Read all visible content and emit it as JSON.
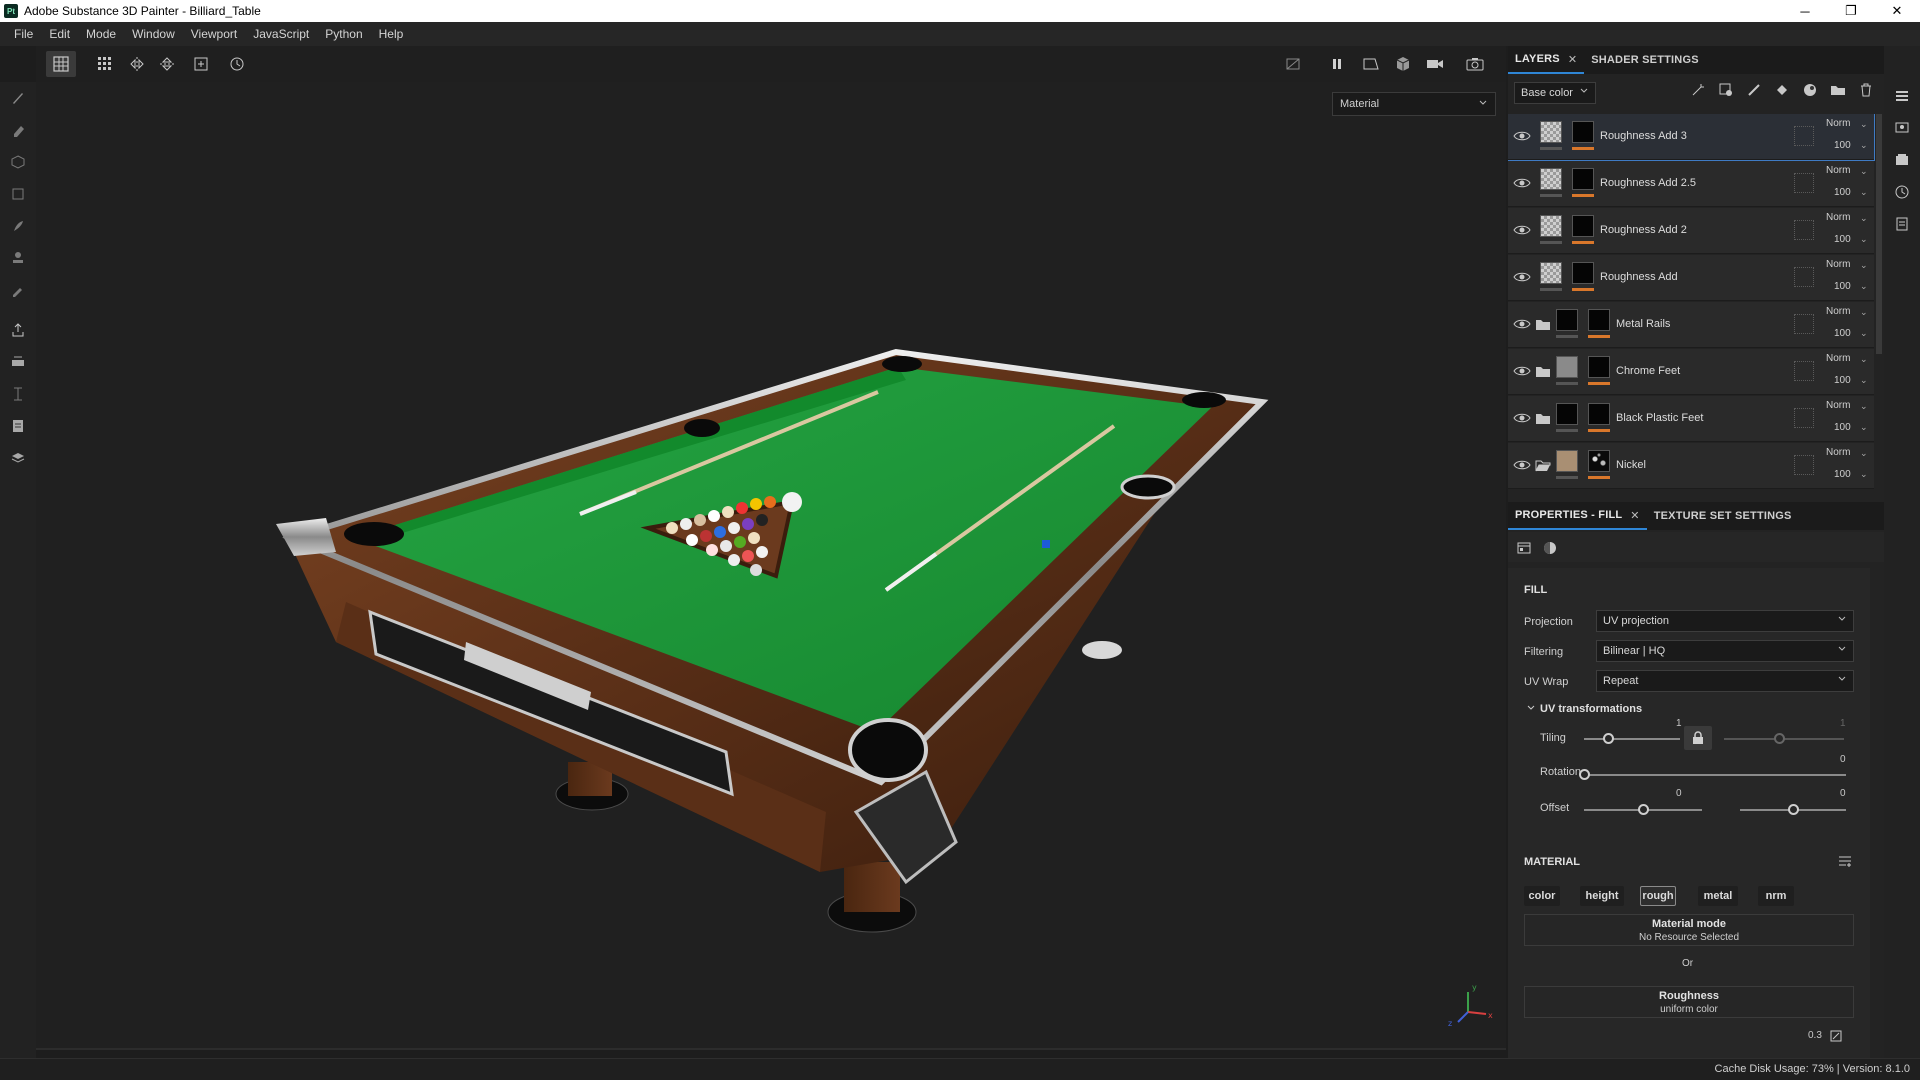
{
  "window": {
    "title": "Adobe Substance 3D Painter - Billiard_Table",
    "app_icon_text": "Pt",
    "controls": [
      "─",
      "❐",
      "✕"
    ]
  },
  "menu": [
    "File",
    "Edit",
    "Mode",
    "Window",
    "Viewport",
    "JavaScript",
    "Python",
    "Help"
  ],
  "viewport": {
    "mode_select": "Material",
    "axis_gizmo": {
      "x": "x",
      "y": "y",
      "z": "z"
    }
  },
  "layers_panel": {
    "tabs": [
      {
        "label": "LAYERS",
        "closable": true,
        "active": true
      },
      {
        "label": "SHADER SETTINGS",
        "closable": false,
        "active": false
      }
    ],
    "channel_select": "Base color",
    "layers": [
      {
        "name": "Roughness Add 3",
        "type": "fill",
        "thumb1": "checker",
        "thumb2": "black",
        "blend": "Norm",
        "opacity": "100",
        "selected": true
      },
      {
        "name": "Roughness Add 2.5",
        "type": "fill",
        "thumb1": "checker",
        "thumb2": "black",
        "blend": "Norm",
        "opacity": "100",
        "selected": false
      },
      {
        "name": "Roughness Add 2",
        "type": "fill",
        "thumb1": "checker",
        "thumb2": "black",
        "blend": "Norm",
        "opacity": "100",
        "selected": false
      },
      {
        "name": "Roughness Add",
        "type": "fill",
        "thumb1": "checker",
        "thumb2": "black",
        "blend": "Norm",
        "opacity": "100",
        "selected": false
      },
      {
        "name": "Metal Rails",
        "type": "folder",
        "thumb1": "black",
        "thumb2": "black",
        "blend": "Norm",
        "opacity": "100",
        "selected": false
      },
      {
        "name": "Chrome Feet",
        "type": "folder",
        "thumb1": "grey",
        "thumb2": "black",
        "blend": "Norm",
        "opacity": "100",
        "selected": false
      },
      {
        "name": "Black Plastic Feet",
        "type": "folder",
        "thumb1": "black",
        "thumb2": "black",
        "blend": "Norm",
        "opacity": "100",
        "selected": false
      },
      {
        "name": "Nickel",
        "type": "folder-open",
        "thumb1": "tan",
        "thumb2": "noise",
        "blend": "Norm",
        "opacity": "100",
        "selected": false
      }
    ]
  },
  "properties_panel": {
    "tabs": [
      {
        "label": "PROPERTIES - FILL",
        "closable": true,
        "active": true
      },
      {
        "label": "TEXTURE SET SETTINGS",
        "closable": false,
        "active": false
      }
    ],
    "fill": {
      "title": "FILL",
      "projection_label": "Projection",
      "projection_value": "UV projection",
      "filtering_label": "Filtering",
      "filtering_value": "Bilinear | HQ",
      "uvwrap_label": "UV Wrap",
      "uvwrap_value": "Repeat"
    },
    "uv_transformations": {
      "title": "UV transformations",
      "tiling_label": "Tiling",
      "tiling_value": "1",
      "tiling_value_locked": "1",
      "rotation_label": "Rotation",
      "rotation_value": "0",
      "offset_label": "Offset",
      "offset_u": "0",
      "offset_v": "0",
      "tiling_level": 0.25,
      "rotation_level": 0.0,
      "offset_u_level": 0.5,
      "offset_v_level": 0.5
    },
    "material": {
      "title": "MATERIAL",
      "channels": [
        {
          "label": "color",
          "on": false
        },
        {
          "label": "height",
          "on": false
        },
        {
          "label": "rough",
          "on": true
        },
        {
          "label": "metal",
          "on": false
        },
        {
          "label": "nrm",
          "on": false
        }
      ],
      "mode_title": "Material mode",
      "mode_value": "No Resource Selected",
      "or_label": "Or",
      "roughness_title": "Roughness",
      "roughness_sub": "uniform color",
      "roughness_value": "0.3"
    }
  },
  "status": {
    "text": "Cache Disk Usage:   73% | Version: 8.1.0"
  },
  "colors": {
    "accent": "#2f86d6",
    "felt": "#1f9b3a",
    "wood": "#6b3a1e",
    "layer_bar": "#d9772b"
  }
}
